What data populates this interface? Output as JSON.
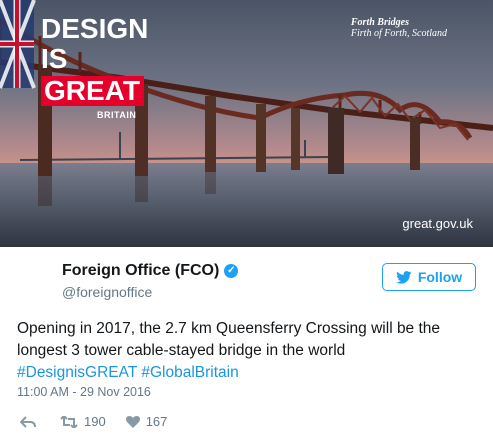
{
  "photo": {
    "logo": {
      "line1": "DESIGN",
      "line2": "IS",
      "line3": "GREAT",
      "line4": "BRITAIN"
    },
    "caption": {
      "line1": "Forth Bridges",
      "line2": "Firth of Forth, Scotland"
    },
    "site": "great.gov.uk"
  },
  "author": {
    "name": "Foreign Office (FCO)",
    "handle": "@foreignoffice",
    "verified_icon": "verified-check-icon"
  },
  "follow_label": "Follow",
  "tweet": {
    "text": "Opening in 2017, the 2.7 km Queensferry Crossing will be the longest 3 tower cable-stayed bridge in the world",
    "hashtag1": "#DesignisGREAT",
    "hashtag2": "#GlobalBritain"
  },
  "timestamp": "11:00 AM - 29 Nov 2016",
  "actions": {
    "retweets": "190",
    "likes": "167"
  },
  "colors": {
    "twitter_blue": "#1da1f2",
    "link_blue": "#1b95e0",
    "great_red": "#e4002b",
    "muted": "#657786"
  }
}
